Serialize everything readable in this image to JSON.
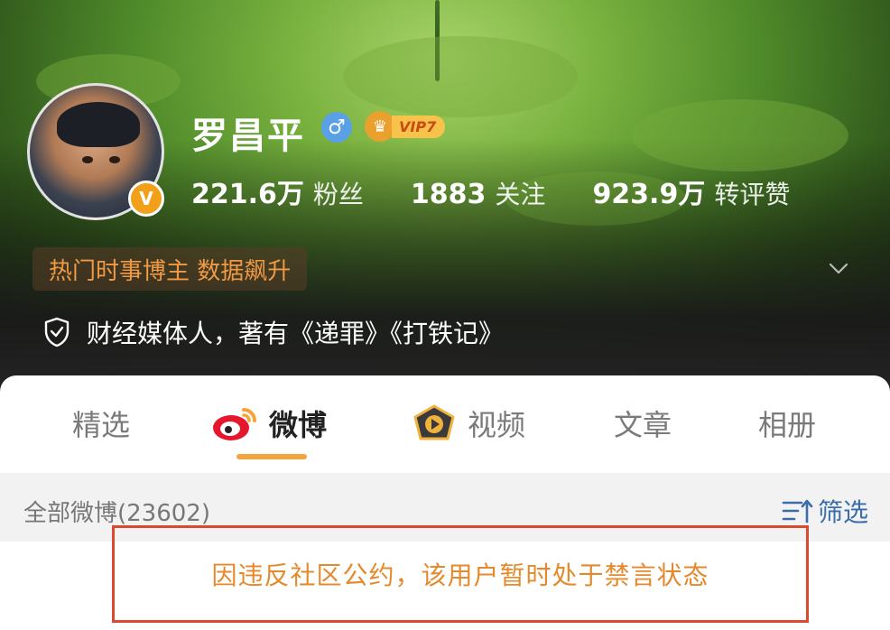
{
  "profile": {
    "name": "罗昌平",
    "gender_symbol": "♂",
    "vip_label": "VIP7",
    "verified_badge": "V",
    "stats": [
      {
        "num": "221.6万",
        "label": "粉丝"
      },
      {
        "num": "1883",
        "label": "关注"
      },
      {
        "num": "923.9万",
        "label": "转评赞"
      }
    ],
    "hot_tag": "热门时事博主 数据飙升",
    "bio": "财经媒体人，著有《递罪》《打铁记》"
  },
  "tabs": [
    {
      "label": "精选",
      "icon": ""
    },
    {
      "label": "微博",
      "icon": "weibo-logo-icon"
    },
    {
      "label": "视频",
      "icon": "video-play-icon"
    },
    {
      "label": "文章",
      "icon": ""
    },
    {
      "label": "相册",
      "icon": ""
    }
  ],
  "feed": {
    "all_count": "全部微博(23602)",
    "filter_label": "筛选"
  },
  "notice": "因违反社区公约，该用户暂时处于禁言状态",
  "colors": {
    "accent_orange": "#f5a33b",
    "notice_text": "#e48a2c",
    "notice_border": "#d94a2e",
    "filter_blue": "#3b6ea8",
    "hot_tag_text": "#f29a43"
  }
}
